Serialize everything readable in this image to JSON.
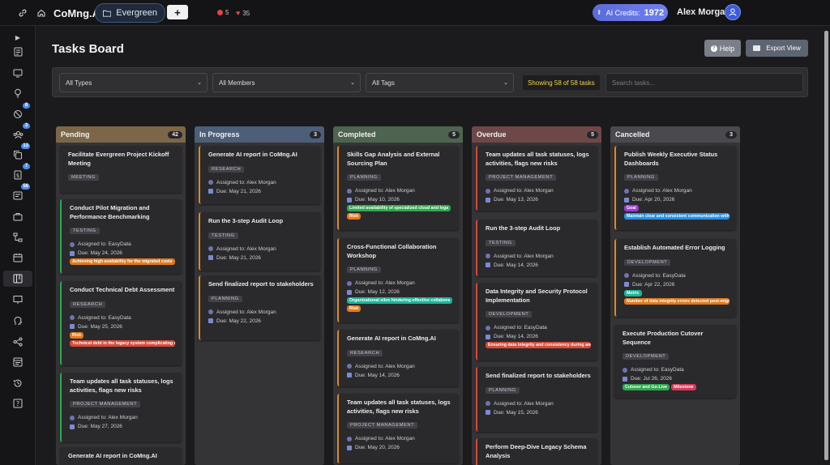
{
  "topbar": {
    "brand": "CoMng.AI",
    "workspace": "Evergreen",
    "add_label": "+",
    "stat_issues": "5",
    "stat_likes": "35",
    "credits_label": "AI Credits:",
    "credits_value": "1972",
    "user_name": "Alex Morgan"
  },
  "sidebar": {
    "badges": [
      "8",
      "3",
      "13",
      "7",
      "58"
    ]
  },
  "page": {
    "title": "Tasks Board",
    "help_label": "Help",
    "export_label": "Export View"
  },
  "filters": {
    "types": "All Types",
    "members": "All Members",
    "tags": "All Tags",
    "showing": "Showing 58 of 58 tasks",
    "search_placeholder": "Search tasks..."
  },
  "columns": [
    {
      "name": "Pending",
      "count": "42",
      "color": "#7b6748"
    },
    {
      "name": "In Progress",
      "count": "3",
      "color": "#4d5f78"
    },
    {
      "name": "Completed",
      "count": "5",
      "color": "#4e6450"
    },
    {
      "name": "Overdue",
      "count": "5",
      "color": "#6e4848"
    },
    {
      "name": "Cancelled",
      "count": "3",
      "color": "#4a4a4e"
    }
  ],
  "cards": {
    "pending": [
      {
        "title": "Facilitate Evergreen Project Kickoff Meeting",
        "tag": "MEETING"
      },
      {
        "title": "Conduct Pilot Migration and Performance Benchmarking",
        "tag": "TESTING",
        "assigned": "Assigned to: EasyData",
        "due": "Due: May 24, 2026",
        "pills": [
          {
            "text": "Achieving high availability for the migrated costs",
            "color": "#e07a1f"
          }
        ]
      },
      {
        "title": "Conduct Technical Debt Assessment",
        "tag": "RESEARCH",
        "assigned": "Assigned to: EasyData",
        "due": "Due: May 25, 2026",
        "pills": [
          {
            "text": "Risk",
            "color": "#e07a1f"
          },
          {
            "text": "Technical debt in the legacy system complicating m",
            "color": "#d64b3a"
          }
        ]
      },
      {
        "title": "Team updates all task statuses, logs activities, flags new risks",
        "tag": "PROJECT MANAGEMENT",
        "assigned": "Assigned to: Alex Morgan",
        "due": "Due: May 27, 2026"
      },
      {
        "title": "Generate AI report in CoMng.AI"
      }
    ],
    "inprogress": [
      {
        "title": "Generate AI report in CoMng.AI",
        "tag": "RESEARCH",
        "assigned": "Assigned to: Alex Morgan",
        "due": "Due: May 21, 2026"
      },
      {
        "title": "Run the 3-step Audit Loop",
        "tag": "TESTING",
        "assigned": "Assigned to: Alex Morgan",
        "due": "Due: May 21, 2026"
      },
      {
        "title": "Send finalized report to stakeholders",
        "tag": "PLANNING",
        "assigned": "Assigned to: Alex Morgan",
        "due": "Due: May 22, 2026"
      }
    ],
    "completed": [
      {
        "title": "Skills Gap Analysis and External Sourcing Plan",
        "tag": "PLANNING",
        "assigned": "Assigned to: Alex Morgan",
        "due": "Due: May 10, 2026",
        "pills": [
          {
            "text": "Limited availability of specialized cloud and lega",
            "color": "#2fa84f"
          },
          {
            "text": "Risk",
            "color": "#e07a1f"
          }
        ]
      },
      {
        "title": "Cross-Functional Collaboration Workshop",
        "tag": "PLANNING",
        "assigned": "Assigned to: Alex Morgan",
        "due": "Due: May 12, 2026",
        "pills": [
          {
            "text": "Organizational silos hindering effective collabora",
            "color": "#1fb39a"
          },
          {
            "text": "Risk",
            "color": "#e07a1f"
          }
        ]
      },
      {
        "title": "Generate AI report in CoMng.AI",
        "tag": "RESEARCH",
        "assigned": "Assigned to: Alex Morgan",
        "due": "Due: May 14, 2026"
      },
      {
        "title": "Team updates all task statuses, logs activities, flags new risks",
        "tag": "PROJECT MANAGEMENT",
        "assigned": "Assigned to: Alex Morgan",
        "due": "Due: May 20, 2026"
      }
    ],
    "overdue": [
      {
        "title": "Team updates all task statuses, logs activities, flags new risks",
        "tag": "PROJECT MANAGEMENT",
        "assigned": "Assigned to: Alex Morgan",
        "due": "Due: May 13, 2026"
      },
      {
        "title": "Run the 3-step Audit Loop",
        "tag": "TESTING",
        "assigned": "Assigned to: Alex Morgan",
        "due": "Due: May 14, 2026"
      },
      {
        "title": "Data Integrity and Security Protocol Implementation",
        "tag": "DEVELOPMENT",
        "assigned": "Assigned to: EasyData",
        "due": "Due: May 14, 2026",
        "pills": [
          {
            "text": "Ensuring data integrity and consistency during and",
            "color": "#d64b3a"
          }
        ]
      },
      {
        "title": "Send finalized report to stakeholders",
        "tag": "PLANNING",
        "assigned": "Assigned to: Alex Morgan",
        "due": "Due: May 15, 2026"
      },
      {
        "title": "Perform Deep-Dive Legacy Schema Analysis"
      }
    ],
    "cancelled": [
      {
        "title": "Publish Weekly Executive Status Dashboards",
        "tag": "PLANNING",
        "assigned": "Assigned to: Alex Morgan",
        "due": "Due: Apr 20, 2026",
        "pills": [
          {
            "text": "Goal",
            "color": "#9b3bd6"
          },
          {
            "text": "Maintain clear and consistent communication with a",
            "color": "#2a8fe0"
          }
        ]
      },
      {
        "title": "Establish Automated Error Logging",
        "tag": "DEVELOPMENT",
        "assigned": "Assigned to: EasyData",
        "due": "Due: Apr 22, 2026",
        "pills": [
          {
            "text": "Metric",
            "color": "#1fb39a"
          },
          {
            "text": "Number of data integrity errors detected post-migr",
            "color": "#e07a1f"
          }
        ]
      },
      {
        "title": "Execute Production Cutover Sequence",
        "tag": "DEVELOPMENT",
        "assigned": "Assigned to: EasyData",
        "due": "Due: Jul 26, 2026",
        "pills": [
          {
            "text": "Cutover and Go-Live",
            "color": "#2fa84f"
          },
          {
            "text": "Milestone",
            "color": "#d63a5a"
          }
        ]
      }
    ]
  },
  "colors": {
    "pending_accent": "#2fa84f",
    "inprogress_accent": "#e08a1f",
    "completed_accent": "#e08a1f",
    "overdue_accent": "#d64b3a",
    "cancelled_accent": "#e08a1f"
  }
}
